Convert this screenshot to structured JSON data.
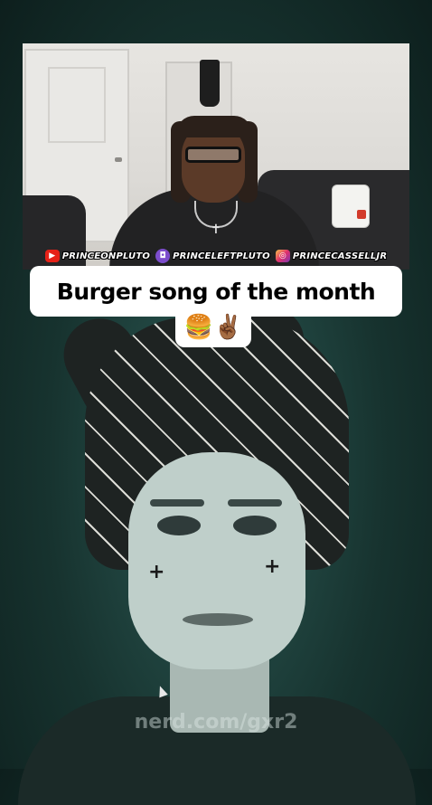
{
  "overlay": {
    "social": [
      {
        "icon": "youtube-icon",
        "handle": "PRINCEONPLUTO"
      },
      {
        "icon": "twitch-icon",
        "handle": "PRINCELEFTPLUTO"
      },
      {
        "icon": "instagram-icon",
        "handle": "PRINCECASSELLJR"
      }
    ],
    "caption_line1": "Burger song of the month",
    "caption_line2": "🍔✌🏾",
    "watermark": "nerd.com/gxr2"
  },
  "colors": {
    "background": "#17332f",
    "caption_bg": "#ffffff",
    "youtube": "#e62117",
    "twitch": "#7c4dcc"
  }
}
